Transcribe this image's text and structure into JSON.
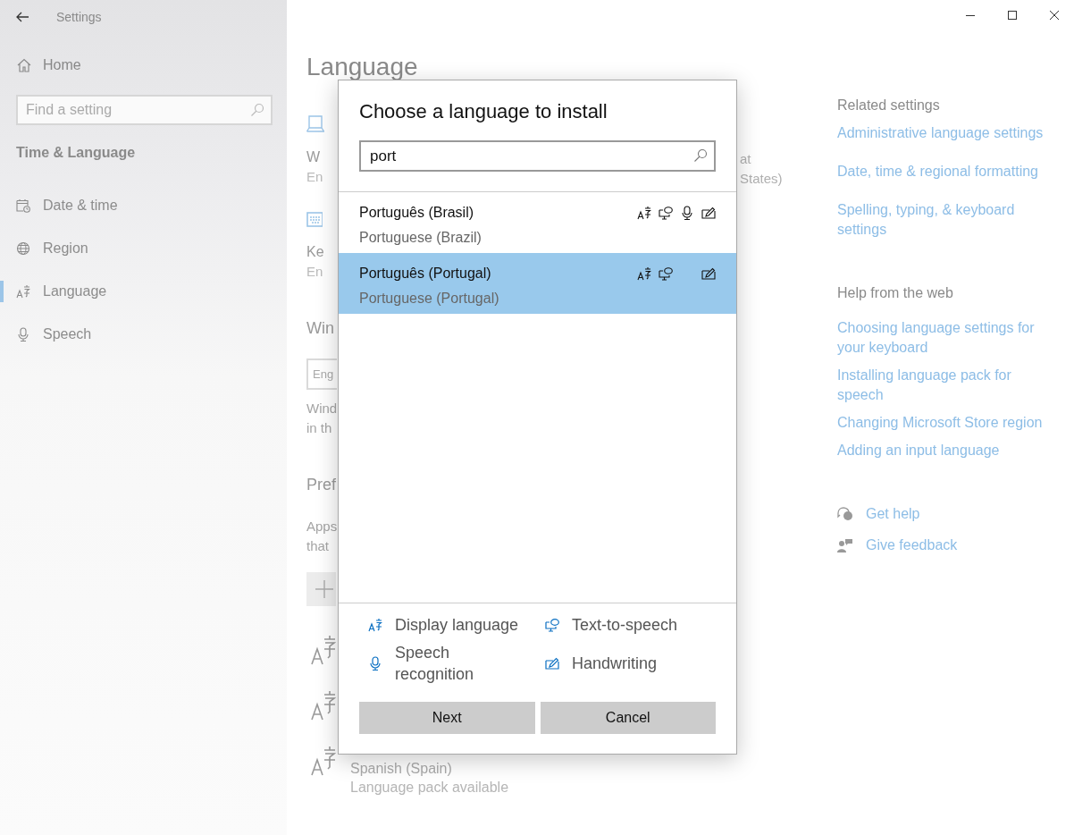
{
  "window": {
    "title": "Settings"
  },
  "sidebar": {
    "home": "Home",
    "search_placeholder": "Find a setting",
    "section": "Time & Language",
    "items": [
      {
        "label": "Date & time",
        "kind": "calendar",
        "selected": false
      },
      {
        "label": "Region",
        "kind": "globe",
        "selected": false
      },
      {
        "label": "Language",
        "kind": "language",
        "selected": true
      },
      {
        "label": "Speech",
        "kind": "mic",
        "selected": false
      }
    ]
  },
  "page": {
    "title": "Language",
    "left_fragments": [
      {
        "kind": "laptop"
      },
      {
        "kind": "name",
        "text": "W"
      },
      {
        "kind": "sub",
        "text": "En"
      },
      {
        "kind": "keyboard"
      },
      {
        "kind": "name",
        "text": "Ke"
      },
      {
        "kind": "sub",
        "text": "En"
      },
      {
        "kind": "heading",
        "text": "Win"
      },
      {
        "kind": "field",
        "text": "Eng"
      },
      {
        "kind": "note",
        "text": "Wind"
      },
      {
        "kind": "note",
        "text": "in th"
      },
      {
        "kind": "heading",
        "text": "Pref"
      },
      {
        "kind": "note",
        "text": "Apps"
      },
      {
        "kind": "note",
        "text": "that"
      },
      {
        "kind": "add"
      },
      {
        "kind": "lang"
      },
      {
        "kind": "lang"
      },
      {
        "kind": "lang",
        "name": "Spanish (Spain)",
        "status": "Language pack available"
      }
    ],
    "right_fragments": [
      "at",
      "States)"
    ]
  },
  "related": {
    "title": "Related settings",
    "links": [
      "Administrative language settings",
      "Date, time & regional formatting",
      "Spelling, typing, & keyboard settings"
    ]
  },
  "help": {
    "title": "Help from the web",
    "links": [
      "Choosing language settings for your keyboard",
      "Installing language pack for speech",
      "Changing Microsoft Store region",
      "Adding an input language"
    ],
    "actions": [
      {
        "kind": "help",
        "label": "Get help"
      },
      {
        "kind": "feedback",
        "label": "Give feedback"
      }
    ]
  },
  "dialog": {
    "title": "Choose a language to install",
    "search": "port",
    "languages": [
      {
        "name": "Português (Brasil)",
        "english": "Portuguese (Brazil)",
        "selected": false,
        "display": true,
        "tts": true,
        "speech": true,
        "handwriting": true
      },
      {
        "name": "Português (Portugal)",
        "english": "Portuguese (Portugal)",
        "selected": true,
        "display": true,
        "tts": true,
        "speech": false,
        "handwriting": true
      }
    ],
    "legend": [
      {
        "kind": "display",
        "label": "Display language"
      },
      {
        "kind": "tts",
        "label": "Text-to-speech"
      },
      {
        "kind": "speech",
        "label": "Speech recognition"
      },
      {
        "kind": "handwriting",
        "label": "Handwriting"
      }
    ],
    "buttons": [
      "Next",
      "Cancel"
    ]
  }
}
